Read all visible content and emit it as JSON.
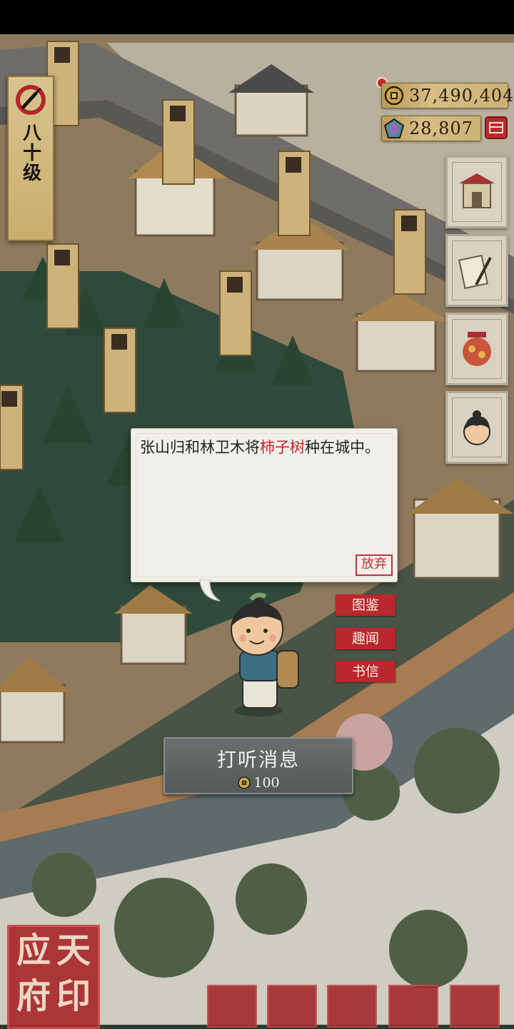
{
  "player": {
    "level_text": "八十级"
  },
  "currency": {
    "coins": "37,490,404",
    "jade": "28,807"
  },
  "dialog": {
    "text_before": "张山归和林卫木将",
    "highlight": "柿子树",
    "text_after": "种在城中。",
    "abandon_label": "放弃"
  },
  "tags": {
    "catalog": "图鉴",
    "anecdotes": "趣闻",
    "letters": "书信"
  },
  "inquire": {
    "label": "打听消息",
    "cost": "100"
  },
  "seal": {
    "chars": [
      "应",
      "天",
      "府",
      "印"
    ]
  },
  "colors": {
    "accent_red": "#b8282c",
    "gold_panel": "#d6be86",
    "dialog_bg": "#f1efe9"
  }
}
